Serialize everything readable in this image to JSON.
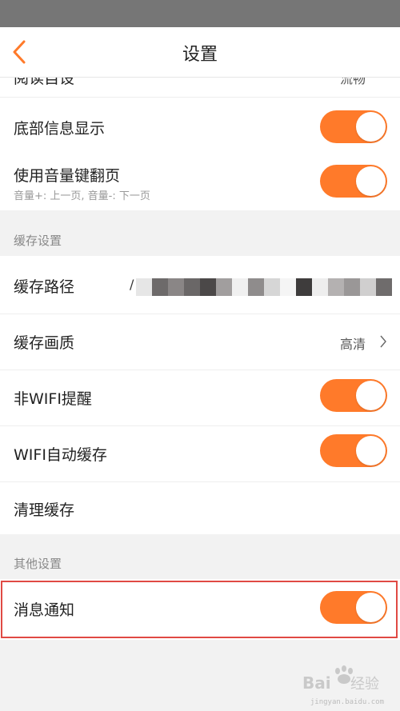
{
  "header": {
    "title": "设置"
  },
  "top_group": {
    "partial_label": "阅读自设",
    "partial_value": "流畅",
    "items": [
      {
        "label": "底部信息显示",
        "toggle_on": true
      },
      {
        "label": "使用音量键翻页",
        "sublabel": "音量+: 上一页, 音量-: 下一页",
        "toggle_on": true
      }
    ]
  },
  "cache_section": {
    "title": "缓存设置",
    "path_label": "缓存路径",
    "path_value_start": "/",
    "quality_label": "缓存画质",
    "quality_value": "高清",
    "non_wifi_label": "非WIFI提醒",
    "wifi_auto_label": "WIFI自动缓存",
    "clear_label": "清理缓存",
    "non_wifi_on": true,
    "wifi_auto_on": true
  },
  "other_section": {
    "title": "其他设置",
    "notify_label": "消息通知",
    "notify_on": true
  },
  "watermark": {
    "brand": "Bai",
    "brand2": "经验",
    "url": "jingyan.baidu.com"
  },
  "colors": {
    "accent": "#ff7a2a",
    "highlight": "#e04a44"
  }
}
